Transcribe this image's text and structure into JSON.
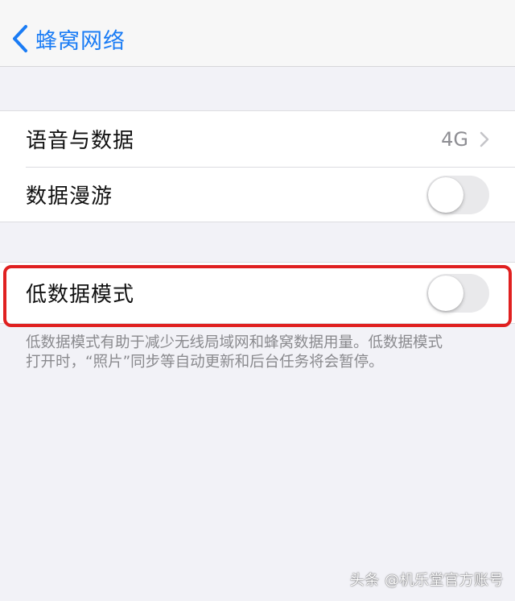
{
  "nav": {
    "back_label": "蜂窝网络"
  },
  "group1": {
    "voice_data": {
      "label": "语音与数据",
      "value": "4G"
    },
    "data_roaming": {
      "label": "数据漫游",
      "toggle": "off"
    }
  },
  "group2": {
    "low_data_mode": {
      "label": "低数据模式",
      "toggle": "off"
    }
  },
  "footnote": {
    "line1": "低数据模式有助于减少无线局域网和蜂窝数据用量。低数据模式",
    "line2": "打开时，“照片”同步等自动更新和后台任务将会暂停。"
  },
  "watermark": "头条 @机乐堂官方账号",
  "colors": {
    "accent": "#1a7cf5",
    "highlight": "#e02020",
    "toggle_off": "#e9e9eb"
  },
  "icons": {
    "back": "chevron-left-icon",
    "disclosure": "chevron-right-icon"
  }
}
